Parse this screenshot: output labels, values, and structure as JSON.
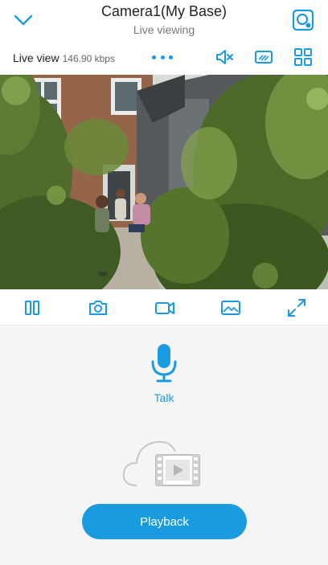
{
  "header": {
    "title": "Camera1(My Base)",
    "subtitle": "Live viewing",
    "back_icon": "chevron-down-icon",
    "camera_icon": "camera-status-icon"
  },
  "status": {
    "live_label": "Live view",
    "bitrate": "146.90 kbps",
    "more_icon": "more-dots-icon",
    "mute_icon": "speaker-mute-icon",
    "sd_icon": "sd-quality-icon",
    "grid_icon": "grid-view-icon"
  },
  "toolbar": {
    "icons": [
      "pause-icon",
      "snapshot-icon",
      "record-icon",
      "image-icon",
      "fullscreen-icon"
    ]
  },
  "talk": {
    "label": "Talk",
    "icon": "microphone-icon"
  },
  "playback": {
    "label": "Playback",
    "illustration": "cloud-video-icon"
  },
  "colors": {
    "accent": "#1a9be0",
    "lower_bg": "#f5f5f6"
  }
}
